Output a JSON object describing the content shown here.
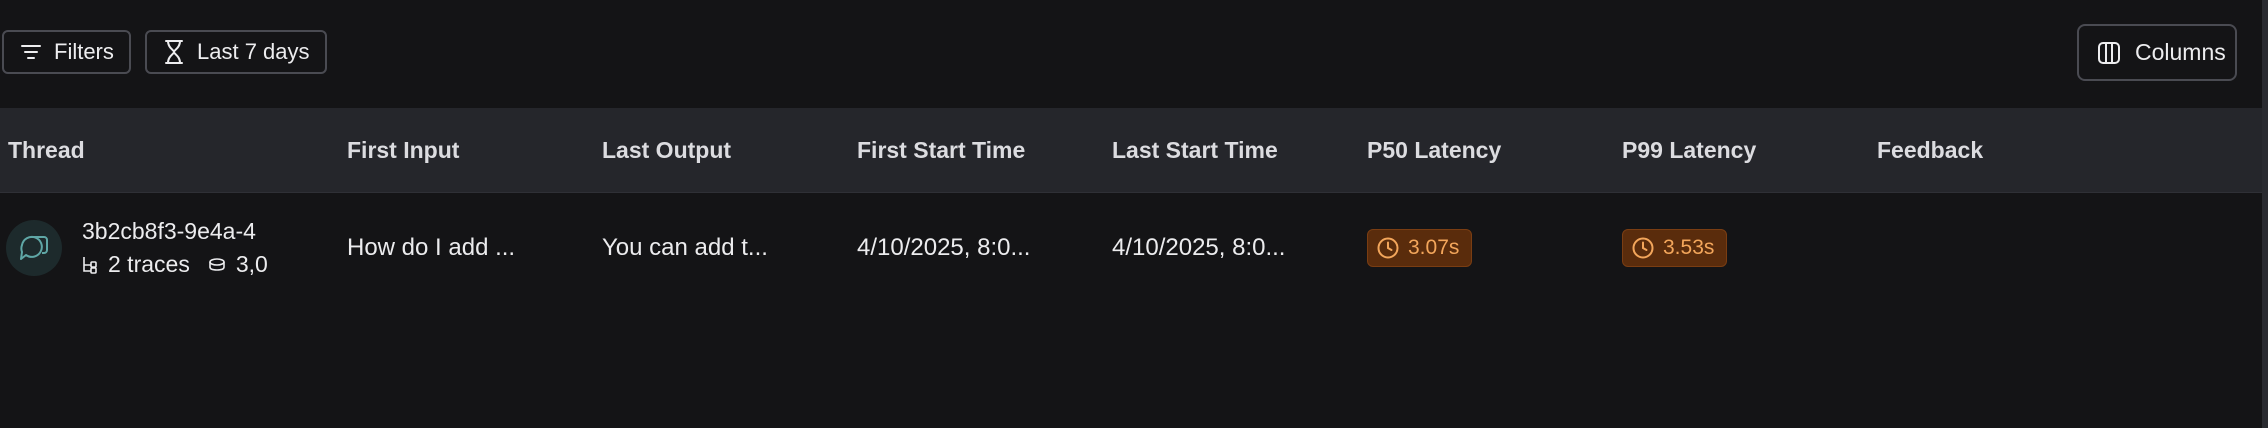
{
  "toolbar": {
    "filters_label": "Filters",
    "date_range_label": "Last 7 days",
    "columns_label": "Columns"
  },
  "table": {
    "columns": [
      "Thread",
      "First Input",
      "Last Output",
      "First Start Time",
      "Last Start Time",
      "P50 Latency",
      "P99 Latency",
      "Feedback"
    ],
    "rows": [
      {
        "thread_id": "3b2cb8f3-9e4a-4",
        "traces": "2 traces",
        "tokens": "3,0",
        "first_input": "How do I add ...",
        "last_output": "You can add t...",
        "first_start_time": "4/10/2025, 8:0...",
        "last_start_time": "4/10/2025, 8:0...",
        "p50_latency": "3.07s",
        "p99_latency": "3.53s",
        "feedback": ""
      }
    ]
  },
  "colors": {
    "background": "#141416",
    "header_background": "#25262b",
    "latency_badge_bg": "#5a2c0c",
    "latency_badge_text": "#f3a65b",
    "avatar_accent": "#5fa7a6"
  },
  "icons": {
    "filters": "filter-lines-icon",
    "date_range": "hourglass-icon",
    "columns": "columns-icon",
    "thread_avatar": "chat-bubbles-icon",
    "traces": "trace-tree-icon",
    "tokens": "coins-stack-icon",
    "latency": "clock-icon"
  }
}
